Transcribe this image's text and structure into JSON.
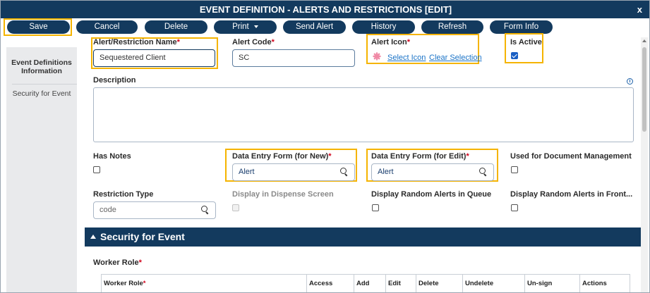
{
  "window": {
    "title": "EVENT DEFINITION - ALERTS AND RESTRICTIONS [EDIT]",
    "close_label": "x"
  },
  "toolbar": {
    "save": "Save",
    "cancel": "Cancel",
    "delete": "Delete",
    "print": "Print",
    "send_alert": "Send Alert",
    "history": "History",
    "refresh": "Refresh",
    "form_info": "Form Info"
  },
  "sidebar": {
    "items": [
      {
        "label": "Event Definitions Information"
      },
      {
        "label": "Security for Event"
      }
    ]
  },
  "form": {
    "alert_name": {
      "label": "Alert/Restriction Name",
      "required": "*",
      "value": "Sequestered Client"
    },
    "alert_code": {
      "label": "Alert Code",
      "required": "*",
      "value": "SC"
    },
    "alert_icon": {
      "label": "Alert Icon",
      "required": "*",
      "select_link": "Select Icon",
      "clear_link": "Clear Selection",
      "icon": "asterisk-flower-icon"
    },
    "is_active": {
      "label": "Is Active",
      "checked": true
    },
    "description": {
      "label": "Description",
      "value": ""
    },
    "has_notes": {
      "label": "Has Notes",
      "checked": false
    },
    "data_entry_new": {
      "label": "Data Entry Form (for New)",
      "required": "*",
      "value": "Alert"
    },
    "data_entry_edit": {
      "label": "Data Entry Form (for Edit)",
      "required": "*",
      "value": "Alert"
    },
    "used_for_doc": {
      "label": "Used for Document Management",
      "checked": false
    },
    "restriction_type": {
      "label": "Restriction Type",
      "placeholder": "code"
    },
    "display_dispense": {
      "label": "Display in Dispense Screen",
      "checked": false,
      "disabled": true
    },
    "display_random_queue": {
      "label": "Display Random Alerts in Queue",
      "checked": false
    },
    "display_random_front": {
      "label": "Display Random Alerts in Front...",
      "checked": false
    }
  },
  "security_section": {
    "title": "Security for Event",
    "worker_role_label": "Worker Role",
    "required": "*",
    "table_headers": [
      "Worker Role",
      "Access",
      "Add",
      "Edit",
      "Delete",
      "Undelete",
      "Un-sign",
      "Actions"
    ]
  },
  "colors": {
    "primary": "#133a5e",
    "highlight": "#f5b400",
    "required": "#d0021b",
    "link": "#1a73c7"
  }
}
